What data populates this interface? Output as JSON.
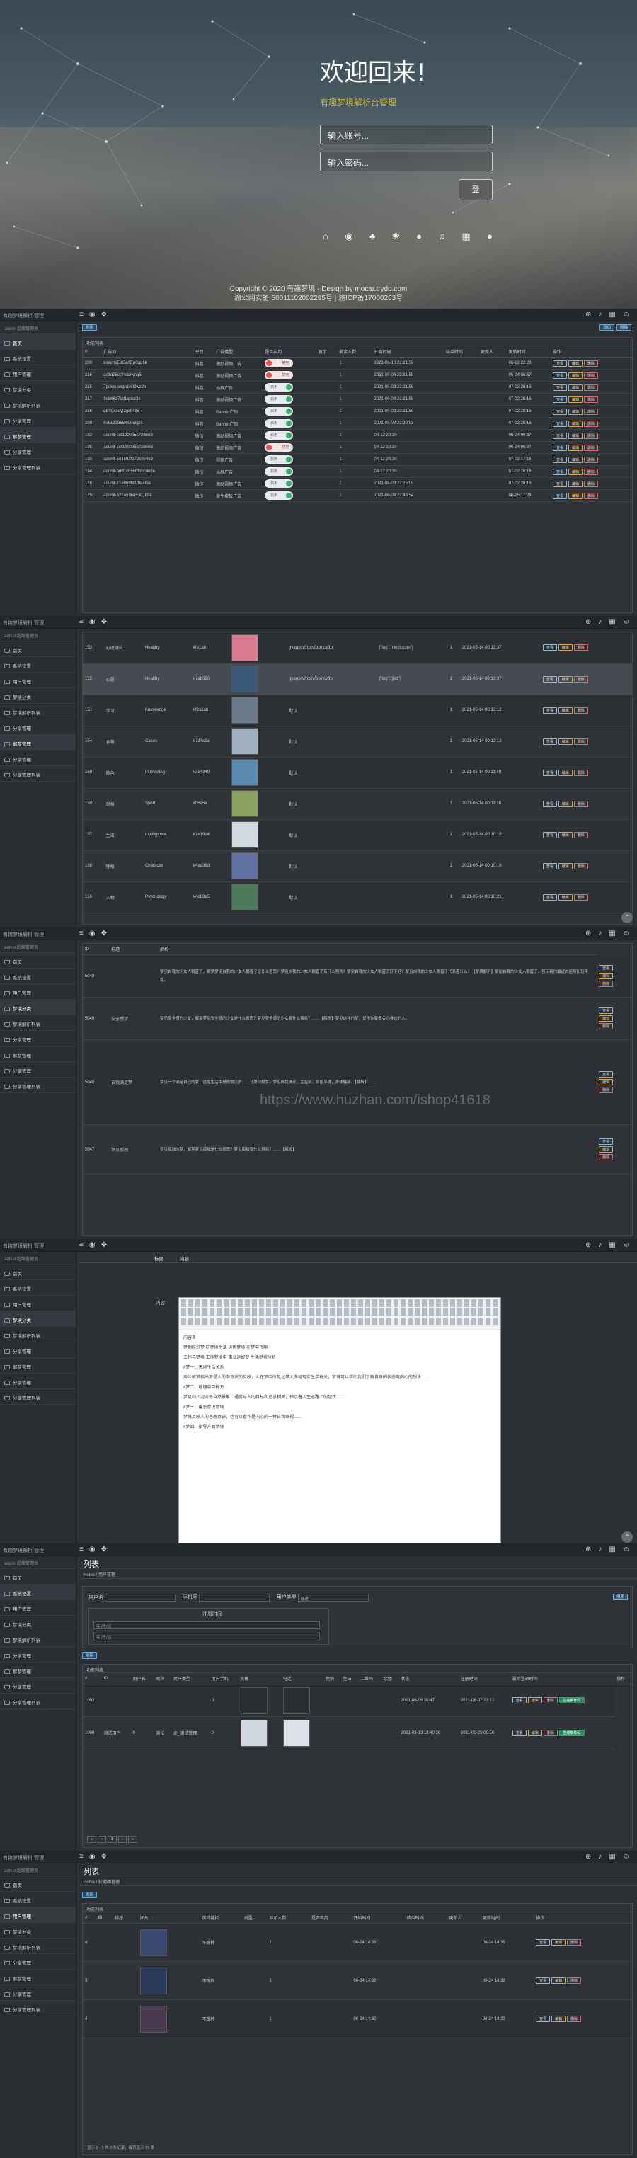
{
  "login": {
    "title": "欢迎回来!",
    "subtitle": "有趣梦境解析台管理",
    "account_placeholder": "输入账号...",
    "password_placeholder": "输入密码...",
    "login_button": "登",
    "copyright": "Copyright © 2020 有趣梦境 - Design by mocar.trydo.com",
    "icp": "渝公网安备 50011102002295号 | 渝ICP备17000263号"
  },
  "admin": {
    "brand": "有趣梦境解析 管理",
    "user_line": "admin  超级管理员",
    "menu": [
      "首页",
      "系统设置",
      "用户管理",
      "梦境分类",
      "梦境解析列表",
      "分享管理",
      "解梦管理",
      "分享管理",
      "分享管理列表"
    ],
    "refresh": "刷新",
    "add": "添加",
    "delete": "删除",
    "edit": "编辑",
    "view": "查看",
    "disable": "禁用",
    "enable": "启用",
    "show": "显示"
  },
  "s1": {
    "panel_title": "功能列表",
    "cols": [
      "#",
      "广告ID",
      "平台",
      "广告类型",
      "是否启用",
      "展示",
      "剩余人数",
      "开始时间",
      "结束时间",
      "更新人",
      "更新时间",
      "操作"
    ],
    "rows": [
      [
        "200",
        "kmkmxEdGa6En0gg6k",
        "抖音",
        "激励视频广告",
        "off",
        "",
        "1",
        "2021-06-10 22:21:59",
        "06-12 22:28"
      ],
      [
        "216",
        "ac3d76ct34daiwng5",
        "抖音",
        "激励视频广告",
        "off",
        "",
        "1",
        "2021-06-03 22:21:59",
        "06-24 06:37"
      ],
      [
        "215",
        "7pdkeuesgh1n02wz2n",
        "抖音",
        "插屏广告",
        "on",
        "",
        "1",
        "2021-06-03 22:21:59",
        "07-02 20:16"
      ],
      [
        "217",
        "9ebh6z7ad1qpkz3e",
        "抖音",
        "激励视频广告",
        "on",
        "",
        "1",
        "2021-06-03 22:21:59",
        "07-02 20:16"
      ],
      [
        "216",
        "g8Ygx3ayl2gxh4ll5",
        "抖音",
        "Banner广告",
        "on",
        "",
        "1",
        "2021-06-03 22:21:59",
        "07-02 20:16"
      ],
      [
        "200",
        "6v51939864x2h6gzs",
        "抖音",
        "Banner广告",
        "on",
        "",
        "1",
        "2021-06-03 22:20:03",
        "07-02 20:16"
      ],
      [
        "163",
        "adunit-cef1900b5c72de6d",
        "微信",
        "激励视频广告",
        "on",
        "",
        "1",
        "04-12 20:30",
        "06-24 06:37"
      ],
      [
        "195",
        "adunit-cef1900b5c72de6d",
        "微信",
        "激励视频广告",
        "off",
        "",
        "1",
        "04-12 20:30",
        "06-24 06:37"
      ],
      [
        "193",
        "adunit-5e1e93fd72c9e4e2",
        "微信",
        "视频广告",
        "on",
        "",
        "1",
        "04-12 20:30",
        "07-02 17:16"
      ],
      [
        "194",
        "adunit-bdd1c9560fbbcde6e",
        "微信",
        "插屏广告",
        "on",
        "",
        "1",
        "04-12 20:30",
        "07-02 20:16"
      ],
      [
        "178",
        "adunit-71e069fa1f9e4f6e",
        "微信",
        "激励视频广告",
        "on",
        "",
        "1",
        "2021-06-03 22:25:09",
        "07-02 20:16"
      ],
      [
        "179",
        "adunit-627a5964530789e",
        "微信",
        "原生模板广告",
        "on",
        "",
        "1",
        "2021-06-03 22:48:54",
        "06-25 17:24"
      ]
    ]
  },
  "s2": {
    "rows": [
      [
        "153",
        "心理测试",
        "Healthy",
        "#fe1ab",
        "gyagxcvfhxcvfbxmcvfbx",
        "{\"log\":\"nimh.com\"}",
        "1",
        "2021-05-14 00:12:37"
      ],
      [
        "155",
        "心愿",
        "Healthy",
        "#7ab090",
        "gyagxcvfhxcvfbxmcvfbx",
        "{\"log\":\"jjkd\"}",
        "1",
        "2021-05-14 00:12:37"
      ],
      [
        "151",
        "学习",
        "Knowledge",
        "#f2a1ab",
        "默认",
        "",
        "1",
        "2021-05-14 00:12:12"
      ],
      [
        "154",
        "食物",
        "Cases",
        "#734c2a",
        "默认",
        "",
        "1",
        "2021-05-14 00:12:12"
      ],
      [
        "169",
        "颜色",
        "Interesting",
        "#ae4349",
        "默认",
        "",
        "1",
        "2021-05-14 00:11:49"
      ],
      [
        "150",
        "风格",
        "Sport",
        "#ff6a5e",
        "默认",
        "",
        "1",
        "2021-05-14 00:11:16"
      ],
      [
        "167",
        "生活",
        "Intelligence",
        "#1e19b4",
        "默认",
        "",
        "1",
        "2021-05-14 00:10:16"
      ],
      [
        "168",
        "性格",
        "Character",
        "#4aa36d",
        "默认",
        "",
        "1",
        "2021-05-14 00:10:16"
      ],
      [
        "166",
        "人物",
        "Psychology",
        "#4d89e5",
        "默认",
        "",
        "1",
        "2021-05-14 00:10:21"
      ]
    ]
  },
  "s3": {
    "cols": [
      "ID",
      "标题",
      "解析"
    ],
    "rows": [
      {
        "id": "5048",
        "title": "",
        "text": "梦见自我的少女人鹅曾子，解梦梦见自我的少女人鹅曾子是什么意思？梦见自我的少女人鹅曾子有什么预兆？梦见自我的少女人鹅曾子好不好？梦见自我的少女人鹅曾子代表着什么？【梦境解析】梦见自我的少女人鹅曾子，预示着你最近的运势比较平稳。"
      },
      {
        "id": "5049",
        "title": "安全感梦",
        "text": "梦见安全感的少女，解梦梦见安全感的少女是什么意思？梦见安全感的少女有什么预兆？……【解析】梦见这样的梦，提示你要多关心身边的人。"
      },
      {
        "id": "5046",
        "title": "自我满足梦",
        "text": "梦见一个满足自己的梦，这在生活中是很常见的……《周公解梦》梦见自我满足，主吉利，财运亨通，身体健康。【解析】……"
      },
      {
        "id": "5047",
        "title": "梦见孤独",
        "text": "梦见孤独的梦，解梦梦见孤独是什么意思？梦见孤独有什么预兆？……【解析】"
      }
    ]
  },
  "s4": {
    "tab1": "标题",
    "tab2": "内容",
    "field_label": "内容",
    "editor_lines": [
      "内容目",
      "梦到吃好梦 吃梦境生活 运势梦境 在梦中飞翔",
      "工作与梦境 工作梦境中 事业运好梦 生活梦境分析",
      "#梦一、天地生活关系",
      "周公解梦指出梦是人的潜意识的反映，人在梦中所见之事大多与现实生活有关，梦境可以帮助我们了解自身的状态与内心的想法……",
      "#梦二、地理与目标方",
      "梦见山川河流等自然景象，通常与人的目标和追求相关，预示着人生道路上的起伏……",
      "#梦三、善恶意识意境",
      "梦境反映人的善恶意识，也可以看作是内心的一种自我审视……",
      "#梦四、指导方面梦境"
    ]
  },
  "s5": {
    "title": "列表",
    "crumb_home": "Home",
    "crumb": "用户管理",
    "filter_labels": [
      "用户名",
      "手机号",
      "用户类型"
    ],
    "filter_type_value": "普通",
    "search": "搜索",
    "date_label": "注册时间",
    "date_values": [
      "年 /月/日",
      "年 /月/日"
    ],
    "panel_title": "功能列表",
    "cols": [
      "#",
      "ID",
      "用户名",
      "昵称",
      "用户类型",
      "用户手机",
      "头像",
      "电话",
      "性别",
      "生日",
      "二维码",
      "余额",
      "状态",
      "注册时间",
      "最后登录时间",
      "操作"
    ],
    "rows": [
      [
        "1002",
        "",
        "",
        "",
        "",
        "0",
        "",
        "",
        "",
        "",
        "2021-06-08 20:47",
        "2021-06-07 22:12"
      ],
      [
        "1000",
        "测试用户",
        "0",
        "测试",
        "虚_测试管理",
        "0",
        "",
        "",
        "",
        "",
        "2021-03-13 13:40:36",
        "2021-05-25 06:56"
      ]
    ],
    "pager": [
      "«",
      "‹",
      "1",
      "›",
      "»"
    ],
    "approve": "生成推荐码"
  },
  "s6": {
    "title": "列表",
    "crumb_home": "Home",
    "crumb": "轮播图管理",
    "panel_title": "功能列表",
    "cols": [
      "#",
      "ID",
      "排序",
      "图片",
      "跳转链接",
      "类型",
      "显示人数",
      "是否启用",
      "开始时间",
      "结束时间",
      "更新人",
      "更新时间",
      "操作"
    ],
    "rows": [
      [
        "4",
        "",
        "不跳转",
        "",
        "1",
        "",
        "06-24 14:35",
        "",
        "06-24 14:35"
      ],
      [
        "3",
        "",
        "不跳转",
        "",
        "1",
        "",
        "06-24 14:32",
        "",
        "06-24 14:32"
      ],
      [
        "4",
        "",
        "不跳转",
        "",
        "1",
        "",
        "06-24 14:32",
        "",
        "06-24 14:32"
      ]
    ],
    "footer": "显示 1 - 3 共 3 条记录，每页显示 15 条"
  },
  "watermark": "https://www.huzhan.com/ishop41618",
  "colors": {
    "accent": "#c9b43c",
    "on": "#34b36a",
    "off": "#e05252",
    "panel": "#2f3337",
    "green_btn": "#2b8a5e"
  }
}
